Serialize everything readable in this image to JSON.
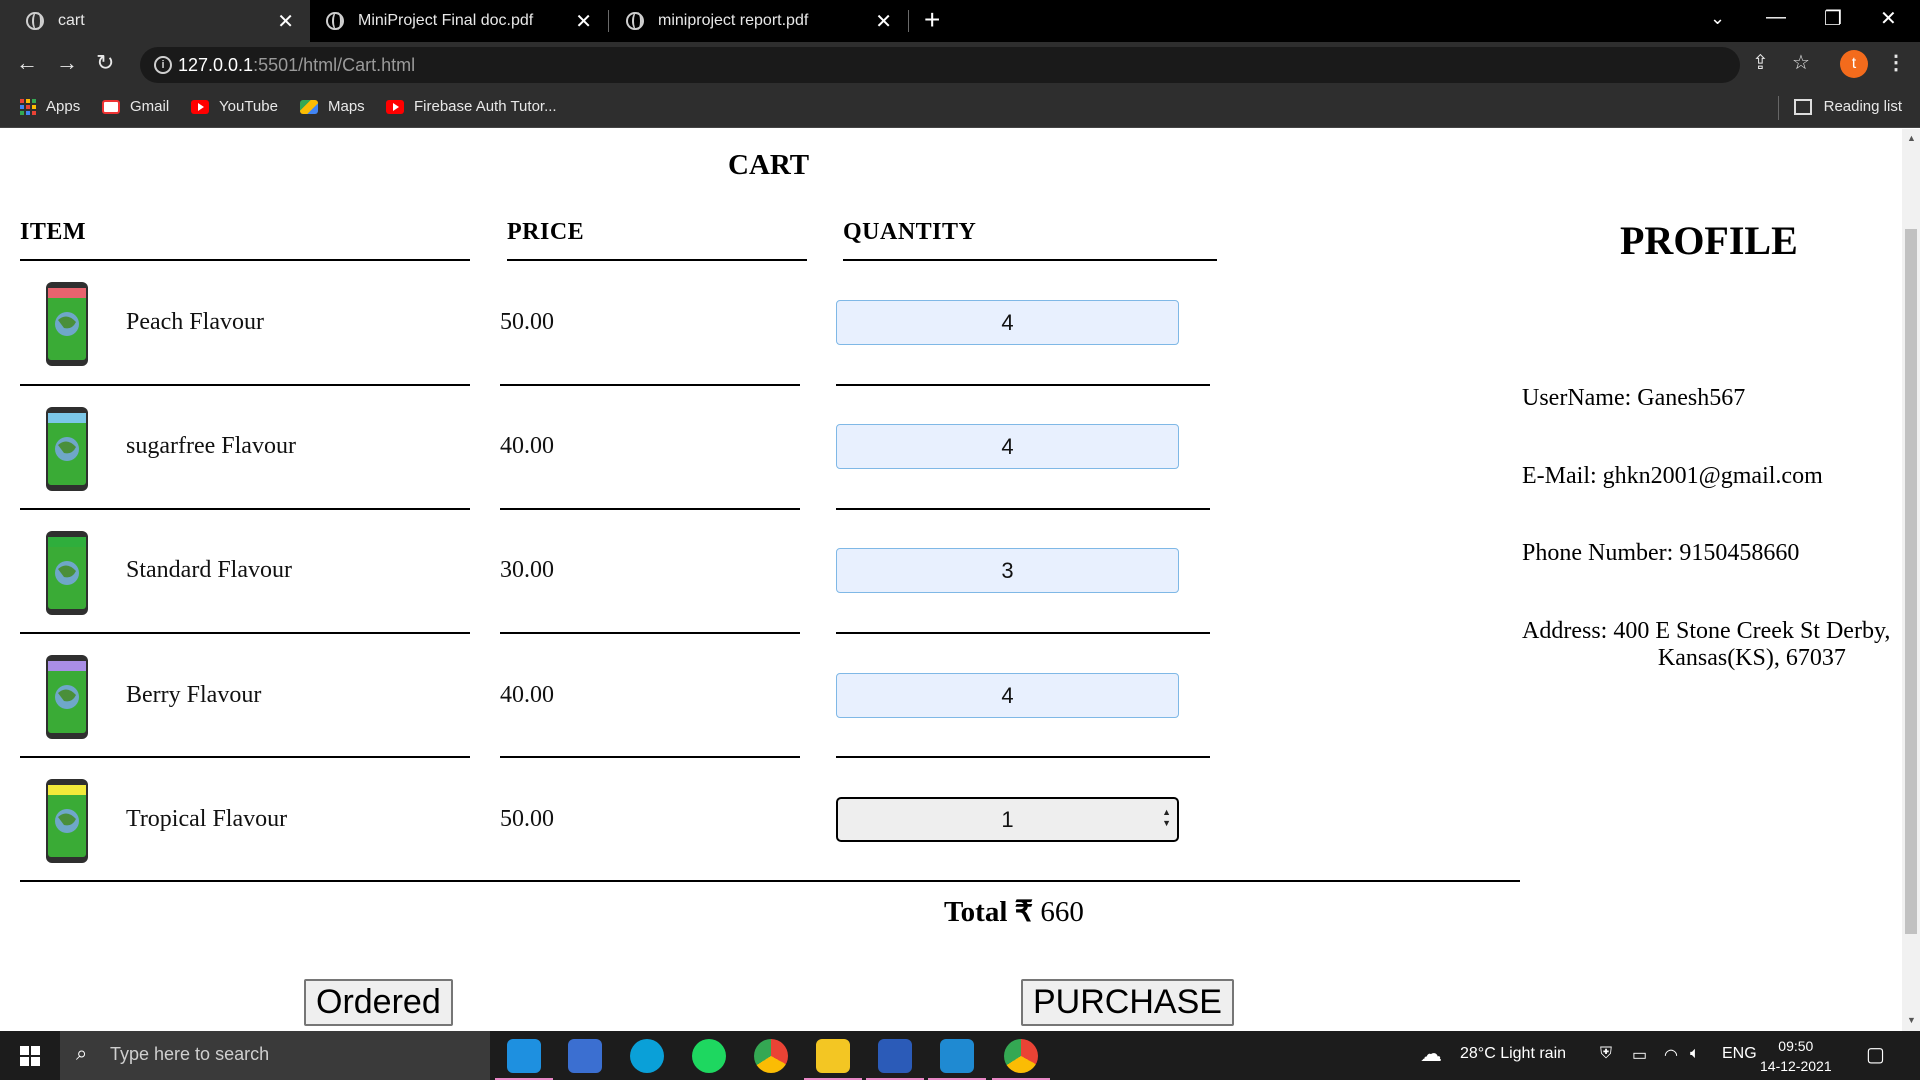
{
  "browser": {
    "tabs": [
      {
        "title": "cart",
        "active": true
      },
      {
        "title": "MiniProject Final doc.pdf",
        "active": false
      },
      {
        "title": "miniproject report.pdf",
        "active": false
      }
    ],
    "url_host": "127.0.0.1",
    "url_path": ":5501/html/Cart.html",
    "avatar_letter": "t",
    "bookmarks": [
      "Apps",
      "Gmail",
      "YouTube",
      "Maps",
      "Firebase Auth Tutor..."
    ],
    "reading_list": "Reading list"
  },
  "cart": {
    "title": "CART",
    "headers": {
      "item": "ITEM",
      "price": "PRICE",
      "quantity": "QUANTITY"
    },
    "items": [
      {
        "name": "Peach Flavour",
        "price": "50.00",
        "quantity": "4",
        "band_color": "#e8636e"
      },
      {
        "name": "sugarfree Flavour",
        "price": "40.00",
        "quantity": "4",
        "band_color": "#7cc7e8"
      },
      {
        "name": "Standard Flavour",
        "price": "30.00",
        "quantity": "3",
        "band_color": "#2fae3c"
      },
      {
        "name": "Berry Flavour",
        "price": "40.00",
        "quantity": "4",
        "band_color": "#a98ee6"
      },
      {
        "name": "Tropical Flavour",
        "price": "50.00",
        "quantity": "1",
        "band_color": "#f2e93a"
      }
    ],
    "total_label": "Total",
    "currency": "₹",
    "total_value": "660",
    "ordered_button": "Ordered",
    "purchase_button": "PURCHASE"
  },
  "profile": {
    "title": "PROFILE",
    "username_label": "UserName:",
    "username": "Ganesh567",
    "email_label": "E-Mail:",
    "email": "ghkn2001@gmail.com",
    "phone_label": "Phone Number:",
    "phone": "9150458660",
    "address_label": "Address:",
    "address_line1": "400 E Stone Creek St Derby,",
    "address_line2": "Kansas(KS), 67037"
  },
  "taskbar": {
    "search_placeholder": "Type here to search",
    "weather": "28°C  Light rain",
    "lang": "ENG",
    "time": "09:50",
    "date": "14-12-2021"
  }
}
